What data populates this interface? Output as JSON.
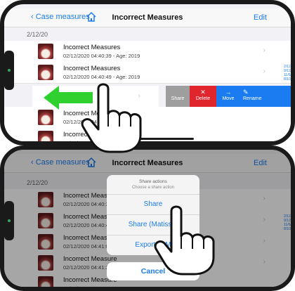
{
  "nav": {
    "back_label": "Case measures",
    "title": "Incorrect Measures",
    "edit_label": "Edit"
  },
  "section_date": "2/12/20",
  "top_rows": [
    {
      "title": "Incorrect Measures",
      "subtitle": "02/12/2020 04:40:39 - Age: 2019"
    },
    {
      "title": "Incorrect Measures",
      "subtitle": "02/12/2020 04:40:49 - Age: 2019"
    },
    {
      "title": "Incorrect Measu",
      "subtitle": "02/12/2020 04:41"
    },
    {
      "title": "Incorrect M",
      "subtitle": "02/12/2020 04"
    }
  ],
  "bottom_rows": [
    {
      "title": "Incorrect Measure",
      "subtitle": "02/12/2020 04:40:39 -"
    },
    {
      "title": "Incorrect Measure",
      "subtitle": "02/12/2020 04:40:49 -"
    },
    {
      "title": "Incorrect Measure",
      "subtitle": "02/12/2020 04:41:01 -"
    },
    {
      "title": "Incorrect Measure",
      "subtitle": "02/12/2020 04:41:25 -"
    },
    {
      "title": "Incorrect Measure",
      "subtitle": "02/12/2020 04:41:53 - Age: 2019"
    }
  ],
  "side_notes": [
    "2/12/2",
    "9/12/",
    "11/6/",
    "8/10/"
  ],
  "swipe_actions": {
    "share": "Share",
    "delete": "Delete",
    "move": "Move",
    "rename": "Rename",
    "delete_icon": "✕",
    "move_icon": "→",
    "rename_icon": "✎"
  },
  "share_sheet": {
    "title": "Share actions",
    "subtitle": "Choose a share action",
    "options": [
      "Share",
      "Share (Matisse)",
      "Export to M"
    ],
    "cancel": "Cancel"
  },
  "colors": {
    "accent": "#1a7cf0",
    "delete": "#e0262c",
    "share": "#9e9e9e",
    "arrow": "#2fd12f"
  },
  "icons": [
    "home-icon",
    "chevron-left-icon",
    "chevron-right-icon",
    "swipe-left-arrow-icon",
    "pointing-hand-icon"
  ]
}
